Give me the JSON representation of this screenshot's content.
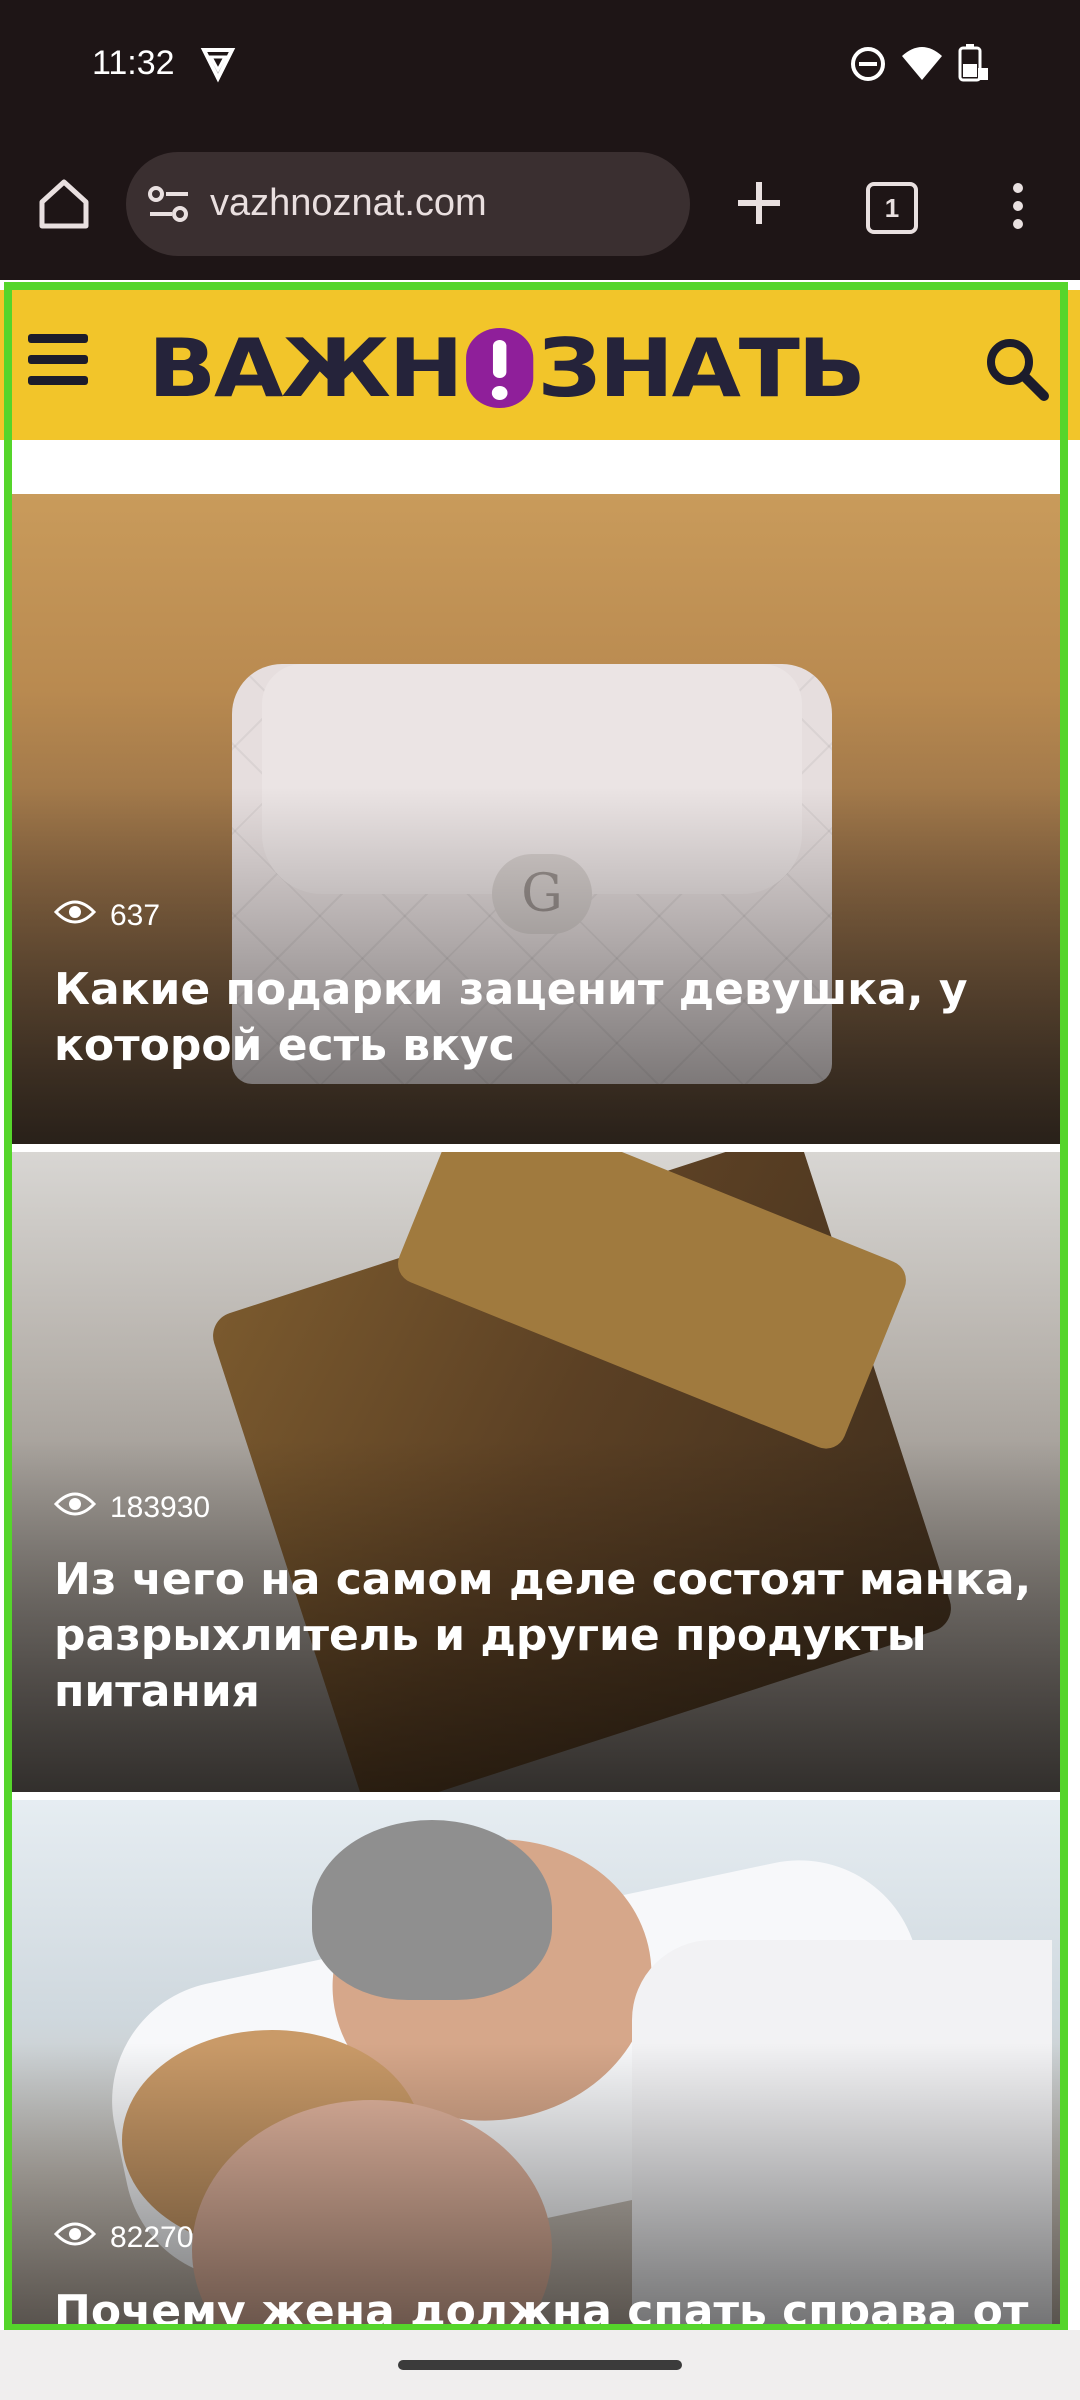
{
  "status": {
    "time": "11:32",
    "icons": [
      "vpn-icon",
      "dnd-icon",
      "wifi-icon",
      "battery-icon"
    ]
  },
  "browser": {
    "url": "vazhnoznat.com",
    "tab_count": "1",
    "icons": [
      "home-icon",
      "site-settings-icon",
      "new-tab-icon",
      "tabs-icon",
      "menu-icon"
    ]
  },
  "site": {
    "logo_left": "ВАЖН",
    "logo_right": "ЗНАТЬ",
    "accent": "#f2c52a",
    "logo_color": "#25233a",
    "logo_excl_color": "#8f1f9a"
  },
  "articles": [
    {
      "views": "637",
      "title": "Какие подарки заценит девушка, у которой есть вкус"
    },
    {
      "views": "183930",
      "title": "Из чего на самом деле состоят манка, разрыхлитель и другие продукты питания"
    },
    {
      "views": "82270",
      "title": "Почему жена должна спать справа от"
    }
  ],
  "highlight_color": "#55d52b"
}
